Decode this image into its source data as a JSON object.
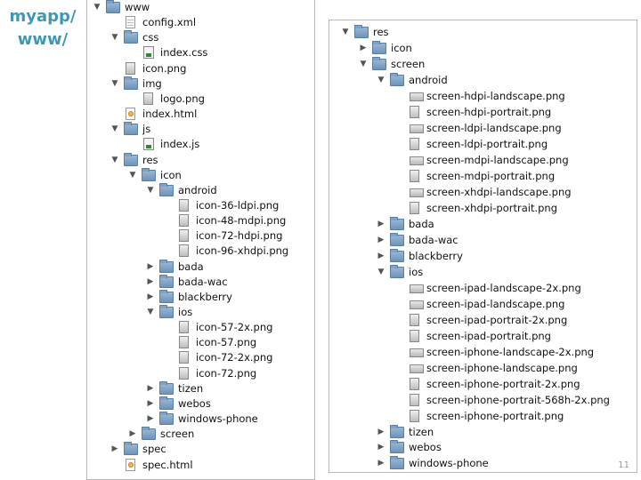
{
  "caption": {
    "line1": "myapp/",
    "line2": "www/"
  },
  "left_tree": [
    {
      "label": "www",
      "icon": "folder",
      "expanded": true,
      "depth": 0
    },
    {
      "label": "config.xml",
      "icon": "file",
      "depth": 1
    },
    {
      "label": "css",
      "icon": "folder",
      "expanded": true,
      "depth": 1
    },
    {
      "label": "index.css",
      "icon": "code",
      "depth": 2
    },
    {
      "label": "icon.png",
      "icon": "image-portrait",
      "depth": 1
    },
    {
      "label": "img",
      "icon": "folder",
      "expanded": true,
      "depth": 1
    },
    {
      "label": "logo.png",
      "icon": "image-portrait",
      "depth": 2
    },
    {
      "label": "index.html",
      "icon": "html",
      "depth": 1
    },
    {
      "label": "js",
      "icon": "folder",
      "expanded": true,
      "depth": 1
    },
    {
      "label": "index.js",
      "icon": "code",
      "depth": 2
    },
    {
      "label": "res",
      "icon": "folder",
      "expanded": true,
      "depth": 1
    },
    {
      "label": "icon",
      "icon": "folder",
      "expanded": true,
      "depth": 2
    },
    {
      "label": "android",
      "icon": "folder",
      "expanded": true,
      "depth": 3
    },
    {
      "label": "icon-36-ldpi.png",
      "icon": "image-portrait",
      "depth": 4
    },
    {
      "label": "icon-48-mdpi.png",
      "icon": "image-portrait",
      "depth": 4
    },
    {
      "label": "icon-72-hdpi.png",
      "icon": "image-portrait",
      "depth": 4
    },
    {
      "label": "icon-96-xhdpi.png",
      "icon": "image-portrait",
      "depth": 4
    },
    {
      "label": "bada",
      "icon": "folder",
      "expanded": false,
      "depth": 3
    },
    {
      "label": "bada-wac",
      "icon": "folder",
      "expanded": false,
      "depth": 3
    },
    {
      "label": "blackberry",
      "icon": "folder",
      "expanded": false,
      "depth": 3
    },
    {
      "label": "ios",
      "icon": "folder",
      "expanded": true,
      "depth": 3
    },
    {
      "label": "icon-57-2x.png",
      "icon": "image-portrait",
      "depth": 4
    },
    {
      "label": "icon-57.png",
      "icon": "image-portrait",
      "depth": 4
    },
    {
      "label": "icon-72-2x.png",
      "icon": "image-portrait",
      "depth": 4
    },
    {
      "label": "icon-72.png",
      "icon": "image-portrait",
      "depth": 4
    },
    {
      "label": "tizen",
      "icon": "folder",
      "expanded": false,
      "depth": 3
    },
    {
      "label": "webos",
      "icon": "folder",
      "expanded": false,
      "depth": 3
    },
    {
      "label": "windows-phone",
      "icon": "folder",
      "expanded": false,
      "depth": 3
    },
    {
      "label": "screen",
      "icon": "folder",
      "expanded": false,
      "depth": 2
    },
    {
      "label": "spec",
      "icon": "folder",
      "expanded": false,
      "depth": 1
    },
    {
      "label": "spec.html",
      "icon": "html",
      "depth": 1
    }
  ],
  "right_tree": [
    {
      "label": "res",
      "icon": "folder",
      "expanded": true,
      "depth": 0
    },
    {
      "label": "icon",
      "icon": "folder",
      "expanded": false,
      "depth": 1
    },
    {
      "label": "screen",
      "icon": "folder",
      "expanded": true,
      "depth": 1
    },
    {
      "label": "android",
      "icon": "folder",
      "expanded": true,
      "depth": 2
    },
    {
      "label": "screen-hdpi-landscape.png",
      "icon": "image-landscape",
      "depth": 3
    },
    {
      "label": "screen-hdpi-portrait.png",
      "icon": "image-portrait",
      "depth": 3
    },
    {
      "label": "screen-ldpi-landscape.png",
      "icon": "image-landscape",
      "depth": 3
    },
    {
      "label": "screen-ldpi-portrait.png",
      "icon": "image-portrait",
      "depth": 3
    },
    {
      "label": "screen-mdpi-landscape.png",
      "icon": "image-landscape",
      "depth": 3
    },
    {
      "label": "screen-mdpi-portrait.png",
      "icon": "image-portrait",
      "depth": 3
    },
    {
      "label": "screen-xhdpi-landscape.png",
      "icon": "image-landscape",
      "depth": 3
    },
    {
      "label": "screen-xhdpi-portrait.png",
      "icon": "image-portrait",
      "depth": 3
    },
    {
      "label": "bada",
      "icon": "folder",
      "expanded": false,
      "depth": 2
    },
    {
      "label": "bada-wac",
      "icon": "folder",
      "expanded": false,
      "depth": 2
    },
    {
      "label": "blackberry",
      "icon": "folder",
      "expanded": false,
      "depth": 2
    },
    {
      "label": "ios",
      "icon": "folder",
      "expanded": true,
      "depth": 2
    },
    {
      "label": "screen-ipad-landscape-2x.png",
      "icon": "image-landscape",
      "depth": 3
    },
    {
      "label": "screen-ipad-landscape.png",
      "icon": "image-landscape",
      "depth": 3
    },
    {
      "label": "screen-ipad-portrait-2x.png",
      "icon": "image-portrait",
      "depth": 3
    },
    {
      "label": "screen-ipad-portrait.png",
      "icon": "image-portrait",
      "depth": 3
    },
    {
      "label": "screen-iphone-landscape-2x.png",
      "icon": "image-landscape",
      "depth": 3
    },
    {
      "label": "screen-iphone-landscape.png",
      "icon": "image-landscape",
      "depth": 3
    },
    {
      "label": "screen-iphone-portrait-2x.png",
      "icon": "image-portrait",
      "depth": 3
    },
    {
      "label": "screen-iphone-portrait-568h-2x.png",
      "icon": "image-portrait",
      "depth": 3
    },
    {
      "label": "screen-iphone-portrait.png",
      "icon": "image-portrait",
      "depth": 3
    },
    {
      "label": "tizen",
      "icon": "folder",
      "expanded": false,
      "depth": 2
    },
    {
      "label": "webos",
      "icon": "folder",
      "expanded": false,
      "depth": 2
    },
    {
      "label": "windows-phone",
      "icon": "folder",
      "expanded": false,
      "depth": 2
    }
  ],
  "slide_number": "11"
}
